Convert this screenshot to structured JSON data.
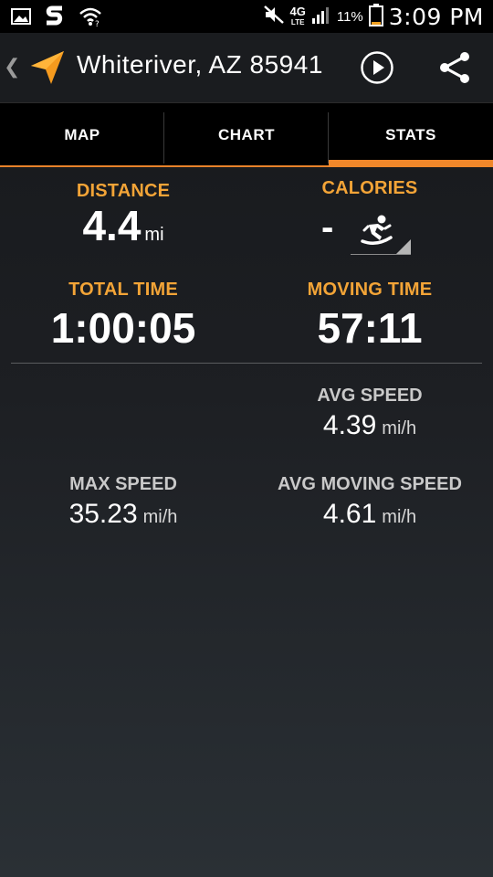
{
  "status_bar": {
    "left_icons": [
      "gallery-icon",
      "s-app-icon",
      "wifi-question-icon"
    ],
    "network": "4G",
    "network_sub": "LTE",
    "battery": "11%",
    "time": "3:09 PM"
  },
  "header": {
    "title": "Whiteriver, AZ 85941",
    "icons": [
      "navigation-arrow-icon",
      "play-icon",
      "share-icon"
    ],
    "accent_color": "#f0872a"
  },
  "tabs": [
    {
      "label": "MAP",
      "selected": false
    },
    {
      "label": "CHART",
      "selected": false
    },
    {
      "label": "STATS",
      "selected": true
    }
  ],
  "stats": {
    "distance": {
      "label": "DISTANCE",
      "value": "4.4",
      "unit": "mi"
    },
    "calories": {
      "label": "CALORIES",
      "value": "-",
      "activity_icon": "snowboarding-icon"
    },
    "total_time": {
      "label": "TOTAL TIME",
      "value": "1:00:05"
    },
    "moving_time": {
      "label": "MOVING TIME",
      "value": "57:11"
    },
    "avg_speed": {
      "label": "AVG SPEED",
      "value": "4.39",
      "unit": "mi/h"
    },
    "max_speed": {
      "label": "MAX SPEED",
      "value": "35.23",
      "unit": "mi/h"
    },
    "avg_moving_speed": {
      "label": "AVG MOVING SPEED",
      "value": "4.61",
      "unit": "mi/h"
    }
  }
}
